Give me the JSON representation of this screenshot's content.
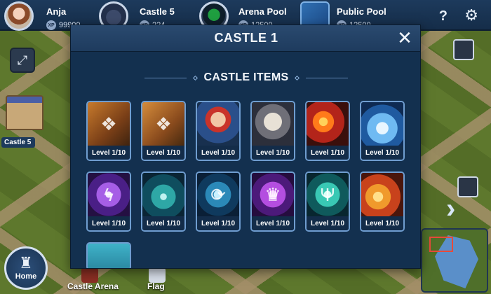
{
  "top_bar": {
    "player": {
      "name": "Anja",
      "xp_label": "XP",
      "xp_value": "99999"
    },
    "slot2": {
      "name": "Castle 5",
      "xp_label": "XP",
      "xp_value": "224"
    },
    "slot3": {
      "name": "Arena Pool",
      "xp_label": "XP",
      "xp_value": "12500"
    },
    "slot4": {
      "name": "Public Pool",
      "xp_label": "XP",
      "xp_value": "12500"
    },
    "help_icon": "?",
    "settings_icon": "⚙"
  },
  "map": {
    "castle_label": "Castle 5",
    "home_label": "Home",
    "bottom_items": [
      "Castle Arena",
      "Flag"
    ]
  },
  "modal": {
    "title": "CASTLE 1",
    "close_icon": "✕",
    "section_title": "CASTLE ITEMS",
    "level_prefix": "Level",
    "items": [
      {
        "name": "cards-orange",
        "level": "1/10"
      },
      {
        "name": "cards-bronze",
        "level": "1/10"
      },
      {
        "name": "warrior",
        "level": "1/10"
      },
      {
        "name": "wizard",
        "level": "1/10"
      },
      {
        "name": "fire",
        "level": "1/10"
      },
      {
        "name": "ice",
        "level": "1/10"
      },
      {
        "name": "lightning",
        "level": "1/10"
      },
      {
        "name": "teal-portal",
        "level": "1/10"
      },
      {
        "name": "cycle",
        "level": "1/10"
      },
      {
        "name": "crown",
        "level": "1/10"
      },
      {
        "name": "menorah",
        "level": "1/10"
      },
      {
        "name": "bomb",
        "level": "1/10"
      }
    ]
  },
  "colors": {
    "modal_bg": "#13304f",
    "header_bg": "#1e3b5e",
    "item_border": "#6f9dd0"
  }
}
